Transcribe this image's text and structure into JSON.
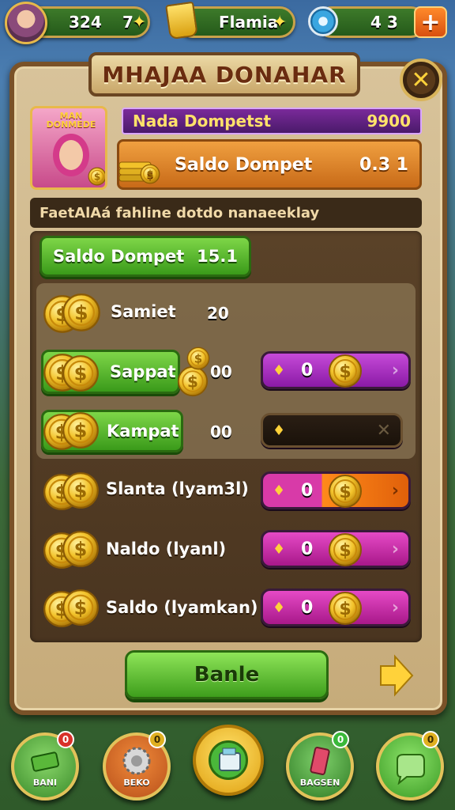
{
  "hud": {
    "coins": "324",
    "level": "7",
    "name": "Flamia",
    "gems": "4 3"
  },
  "dialog": {
    "title": "MHAJAA DONAHAR",
    "profile_badge": "MAN DONMEDE",
    "name_bar": {
      "label": "Nada Dompetst",
      "value": "9900"
    },
    "saldo_bar": {
      "label": "Saldo Dompet",
      "value": "0.3 1"
    },
    "subheader": "FaetAlAá fahline dotdo nanaeeklay",
    "main_button": {
      "label": "Saldo Dompet",
      "value": "15.1"
    },
    "rows": [
      {
        "label": "Samiet",
        "value": "20"
      },
      {
        "label": "Sappat",
        "value": "00",
        "slider_value": "0"
      },
      {
        "label": "Kampat",
        "value": "00"
      },
      {
        "label": "Slanta (lyam3l)",
        "slider_value": "0"
      },
      {
        "label": "Naldo (lyanl)",
        "slider_value": "0"
      },
      {
        "label": "Saldo (lyamkan)",
        "slider_value": "0"
      }
    ],
    "confirm_label": "Banle"
  },
  "nav": [
    {
      "label": "BANI",
      "badge": "0"
    },
    {
      "label": "BEKO",
      "badge": "0"
    },
    {
      "label": "",
      "badge": ""
    },
    {
      "label": "BAGSEN",
      "badge": "0"
    },
    {
      "label": "",
      "badge": "0"
    }
  ],
  "colors": {
    "panel": "#c6ab7a",
    "green_button": "#3a9a1a",
    "purple_slider": "#8a1aa6",
    "magenta_slider": "#a8188a",
    "orange_accent": "#ff8a1a",
    "gold": "#e2c25a"
  },
  "icons": [
    "avatar-icon",
    "star-plus-icon",
    "trophy-cup-icon",
    "gem-icon",
    "plus-icon",
    "close-icon",
    "coin-stack-icon",
    "coin-icon",
    "arrow-right-icon",
    "cash-icon",
    "gear-icon",
    "cash-register-icon",
    "phone-icon",
    "chat-bubble-icon"
  ]
}
